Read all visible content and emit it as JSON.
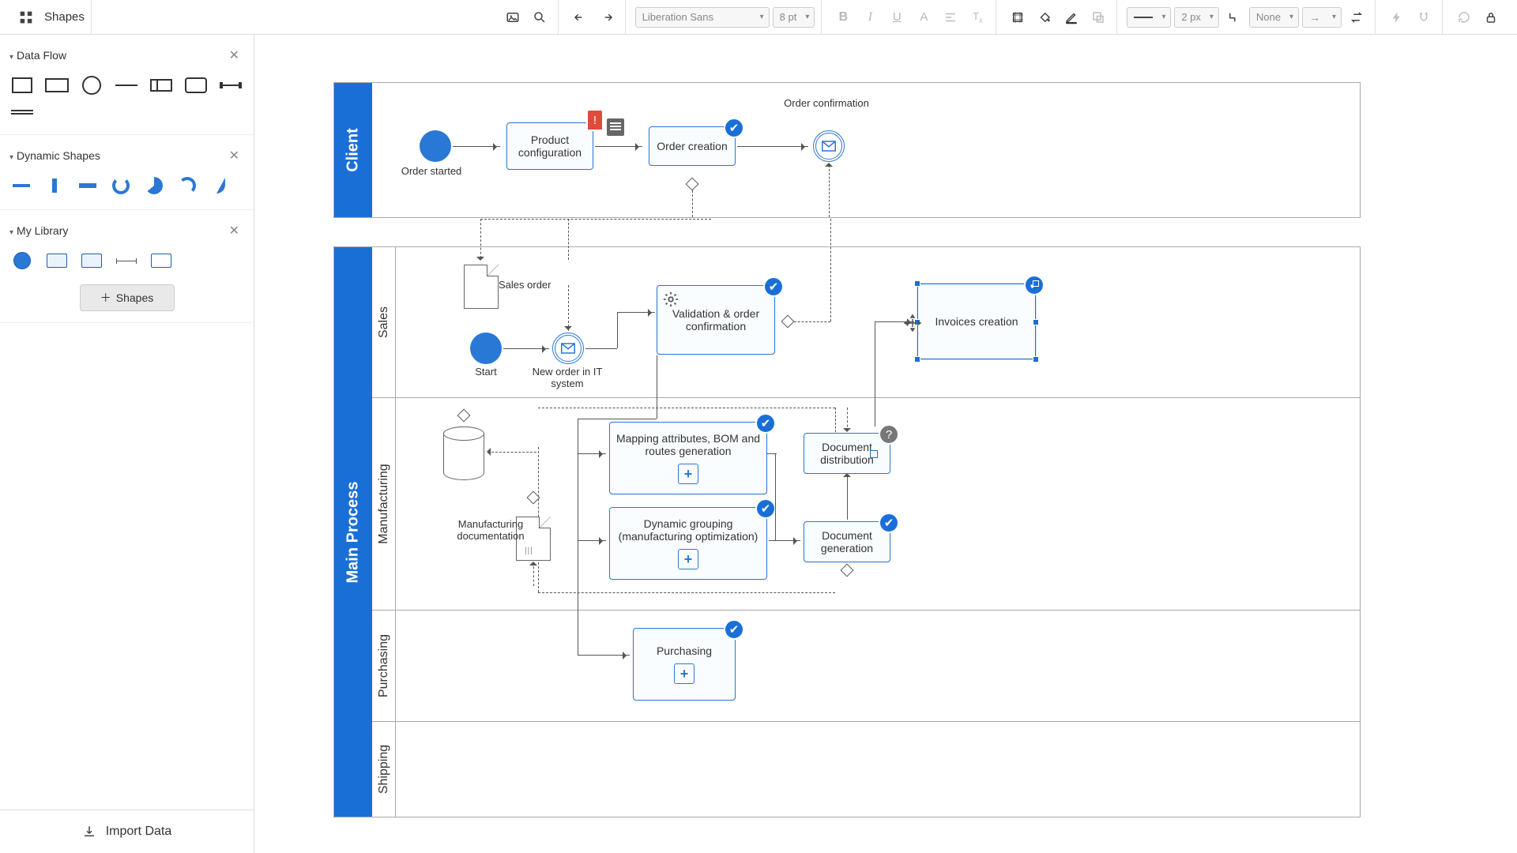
{
  "toolbar": {
    "shapes_label": "Shapes",
    "font_family": "Liberation Sans",
    "font_size": "8 pt",
    "stroke_width": "2 px",
    "line_start": "None"
  },
  "sidepanel": {
    "sections": {
      "dataflow": {
        "title": "Data Flow"
      },
      "dynamic": {
        "title": "Dynamic Shapes"
      },
      "library": {
        "title": "My Library"
      }
    },
    "add_shapes": "Shapes",
    "import_data": "Import Data"
  },
  "pools": {
    "client": {
      "title": "Client"
    },
    "main": {
      "title": "Main Process"
    }
  },
  "lanes": {
    "sales": "Sales",
    "manufacturing": "Manufacturing",
    "purchasing": "Purchasing",
    "shipping": "Shipping"
  },
  "nodes": {
    "order_started": "Order started",
    "product_config": "Product configuration",
    "order_creation": "Order creation",
    "order_confirmation": "Order confirmation",
    "sales_order": "Sales order",
    "start": "Start",
    "new_order_it": "New order in IT system",
    "validation": "Validation & order confirmation",
    "invoices_creation": "Invoices creation",
    "mapping": "Mapping attributes, BOM and routes generation",
    "dynamic_grouping": "Dynamic grouping (manufacturing optimization)",
    "doc_distribution": "Document distribution",
    "doc_generation": "Document generation",
    "mfg_docs": "Manufacturing documentation",
    "purchasing": "Purchasing"
  }
}
